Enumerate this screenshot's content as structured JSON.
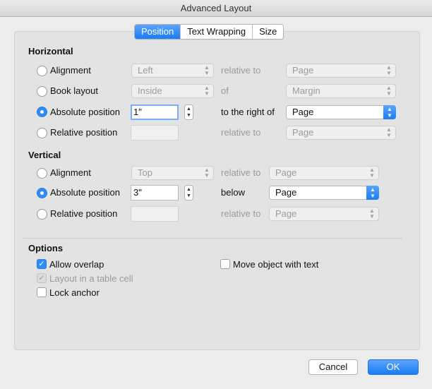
{
  "window": {
    "title": "Advanced Layout"
  },
  "tabs": [
    {
      "label": "Position",
      "active": true
    },
    {
      "label": "Text Wrapping",
      "active": false
    },
    {
      "label": "Size",
      "active": false
    }
  ],
  "horizontal": {
    "title": "Horizontal",
    "rows": [
      {
        "option": "Alignment",
        "selected": false,
        "value": "Left",
        "relation": "relative to",
        "target": "Page"
      },
      {
        "option": "Book layout",
        "selected": false,
        "value": "Inside",
        "relation": "of",
        "target": "Margin"
      },
      {
        "option": "Absolute position",
        "selected": true,
        "value": "1\"",
        "relation": "to the right of",
        "target": "Page"
      },
      {
        "option": "Relative position",
        "selected": false,
        "value": "",
        "relation": "relative to",
        "target": "Page"
      }
    ]
  },
  "vertical": {
    "title": "Vertical",
    "rows": [
      {
        "option": "Alignment",
        "selected": false,
        "value": "Top",
        "relation": "relative to",
        "target": "Page"
      },
      {
        "option": "Absolute position",
        "selected": true,
        "value": "3\"",
        "relation": "below",
        "target": "Page"
      },
      {
        "option": "Relative position",
        "selected": false,
        "value": "",
        "relation": "relative to",
        "target": "Page"
      }
    ]
  },
  "options": {
    "title": "Options",
    "allow_overlap": {
      "label": "Allow overlap",
      "checked": true
    },
    "layout_in_table_cell": {
      "label": "Layout in a table cell",
      "checked": true,
      "disabled": true
    },
    "lock_anchor": {
      "label": "Lock anchor",
      "checked": false
    },
    "move_with_text": {
      "label": "Move object with text",
      "checked": false
    }
  },
  "buttons": {
    "cancel": "Cancel",
    "ok": "OK"
  },
  "colors": {
    "accent": "#1a7cf4",
    "panel": "#e3e3e3",
    "window": "#ececec"
  },
  "icons": {
    "stepper": "up-down-stepper-icon",
    "popup": "up-down-chevron-icon",
    "check": "checkmark-icon"
  }
}
